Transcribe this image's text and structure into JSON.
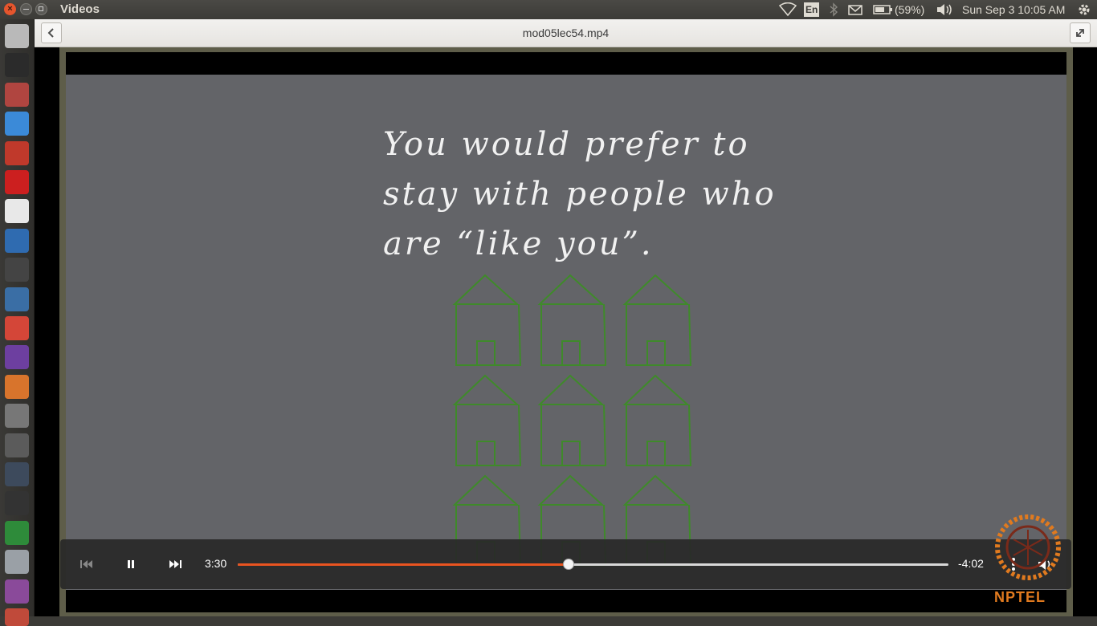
{
  "window": {
    "app_title": "Videos"
  },
  "tray": {
    "keyboard_layout": "En",
    "battery_percent": "(59%)",
    "clock": "Sun Sep  3 10:05 AM"
  },
  "launcher": {
    "items": [
      "dash-icon",
      "terminal-icon",
      "files-icon",
      "chrome-icon",
      "settings-icon",
      "opera-icon",
      "document-viewer-icon",
      "r-icon",
      "video-editor-icon",
      "writer-icon",
      "gmail-icon",
      "media-icon",
      "impress-icon",
      "text-editor-icon",
      "sublime-icon",
      "ipython-icon",
      "geogebra-icon",
      "calc-icon",
      "drive-icon",
      "archive-icon",
      "workspace-icon"
    ]
  },
  "header": {
    "video_title": "mod05lec54.mp4"
  },
  "slide": {
    "line1": "You would prefer to",
    "line2": "stay with people who",
    "line3": "are “like you”."
  },
  "player": {
    "time_elapsed": "3:30",
    "time_remaining": "-4:02",
    "progress_fraction": 0.465
  },
  "watermark": {
    "logo_text": "NPTEL"
  },
  "colors": {
    "accent": "#e95420",
    "house_stroke": "#3f8a2a",
    "slide_bg": "#636468"
  }
}
